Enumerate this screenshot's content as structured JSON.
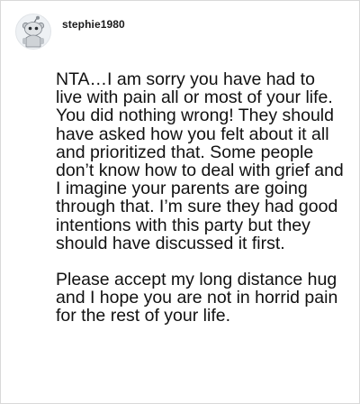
{
  "comment": {
    "author": "stephie1980",
    "avatar_icon": "reddit-snoo-avatar-icon",
    "paragraphs": [
      "NTA…I am sorry you have had to live with pain all or most of your life. You did nothing wrong! They should have asked how you felt about it all and prioritized that. Some people don’t know how to deal with grief and I imagine your parents are going through that. I’m sure they had good intentions with this party but they should have discussed it first.",
      "Please accept my long distance hug and I hope you are not in horrid pain for the rest of your life."
    ]
  },
  "colors": {
    "border": "#d9d9d9",
    "text": "#111111",
    "username": "#1a1a1b"
  }
}
